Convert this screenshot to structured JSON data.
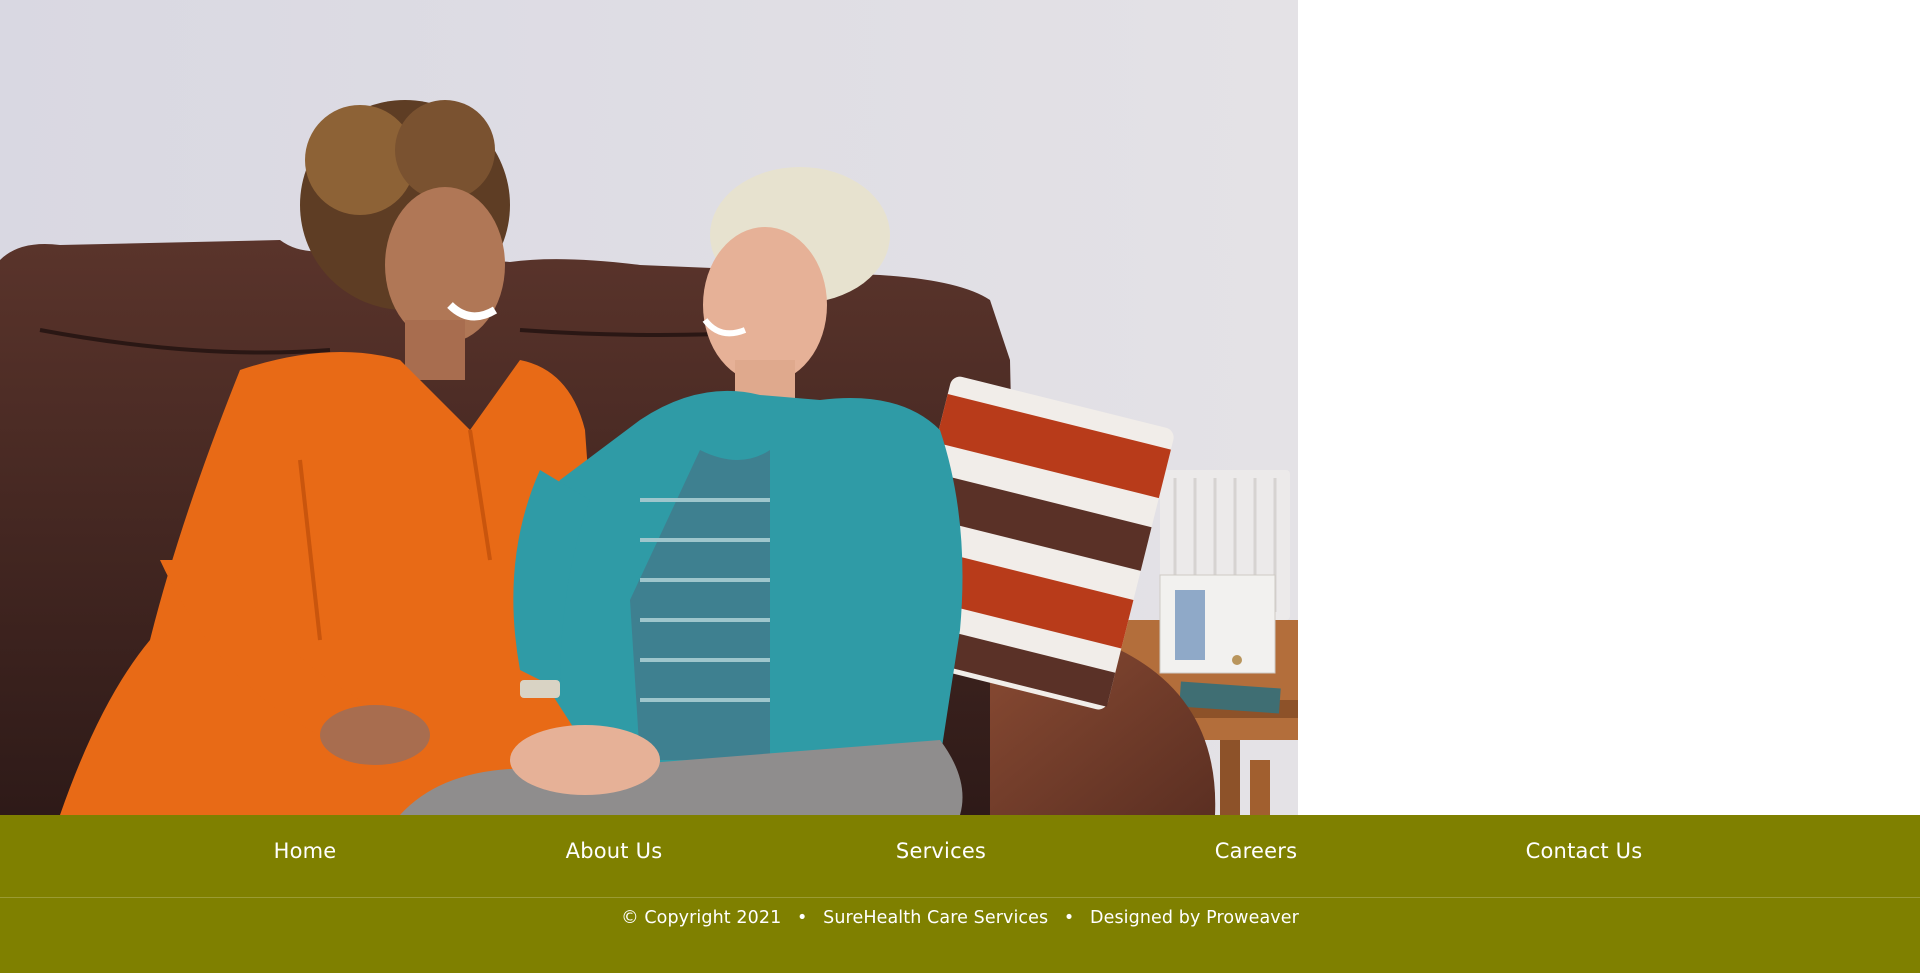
{
  "hero": {
    "image_description_icon": "hero-photo",
    "colors": {
      "wall": "#dcdbe3",
      "sofa": "#4a2a22",
      "orange_dress": "#e86a16",
      "teal_cardigan": "#2f9ba6"
    }
  },
  "footer": {
    "background": "#7f8000",
    "nav": [
      {
        "label": "Home"
      },
      {
        "label": "About Us"
      },
      {
        "label": "Services"
      },
      {
        "label": "Careers"
      },
      {
        "label": "Contact Us"
      }
    ],
    "copyright": "© Copyright 2021",
    "separator": "•",
    "company": "SureHealth Care Services",
    "designed_prefix": "Designed by",
    "designer": "Proweaver"
  }
}
